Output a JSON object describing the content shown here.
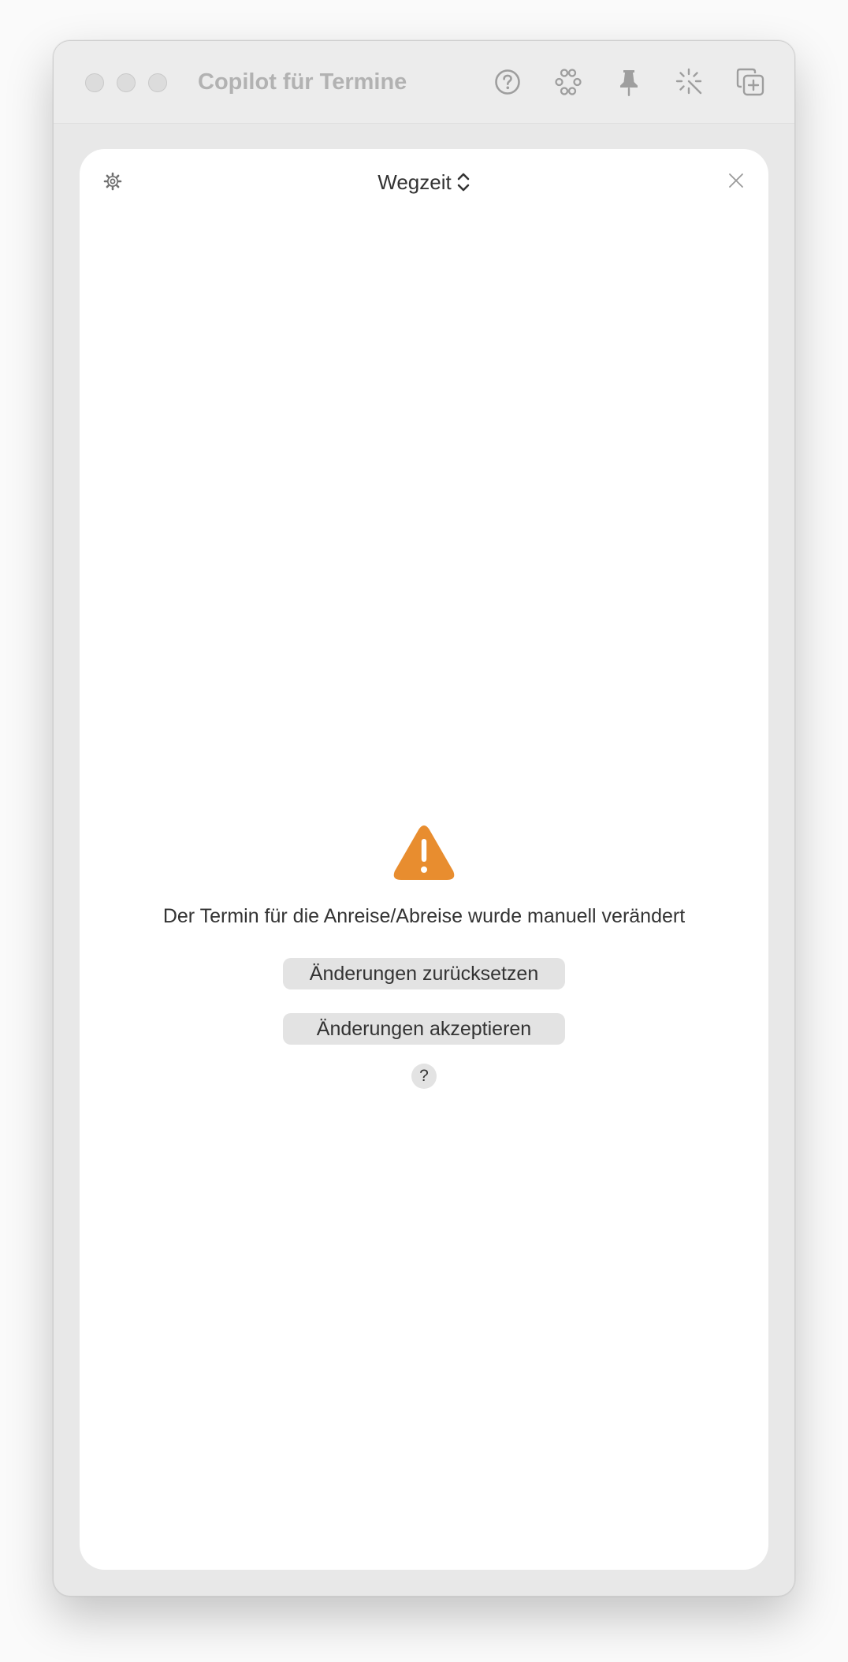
{
  "window": {
    "title": "Copilot für Termine"
  },
  "toolbar": {
    "icons": [
      "help-icon",
      "nodes-icon",
      "pin-icon",
      "magic-wand-icon",
      "add-window-icon"
    ]
  },
  "panel": {
    "selector_label": "Wegzeit"
  },
  "alert": {
    "icon": "warning-icon",
    "icon_color": "#e88d2f",
    "message": "Der Termin für die Anreise/Abreise wurde manuell verändert",
    "reset_button": "Änderungen zurücksetzen",
    "accept_button": "Änderungen akzeptieren",
    "help_label": "?"
  }
}
